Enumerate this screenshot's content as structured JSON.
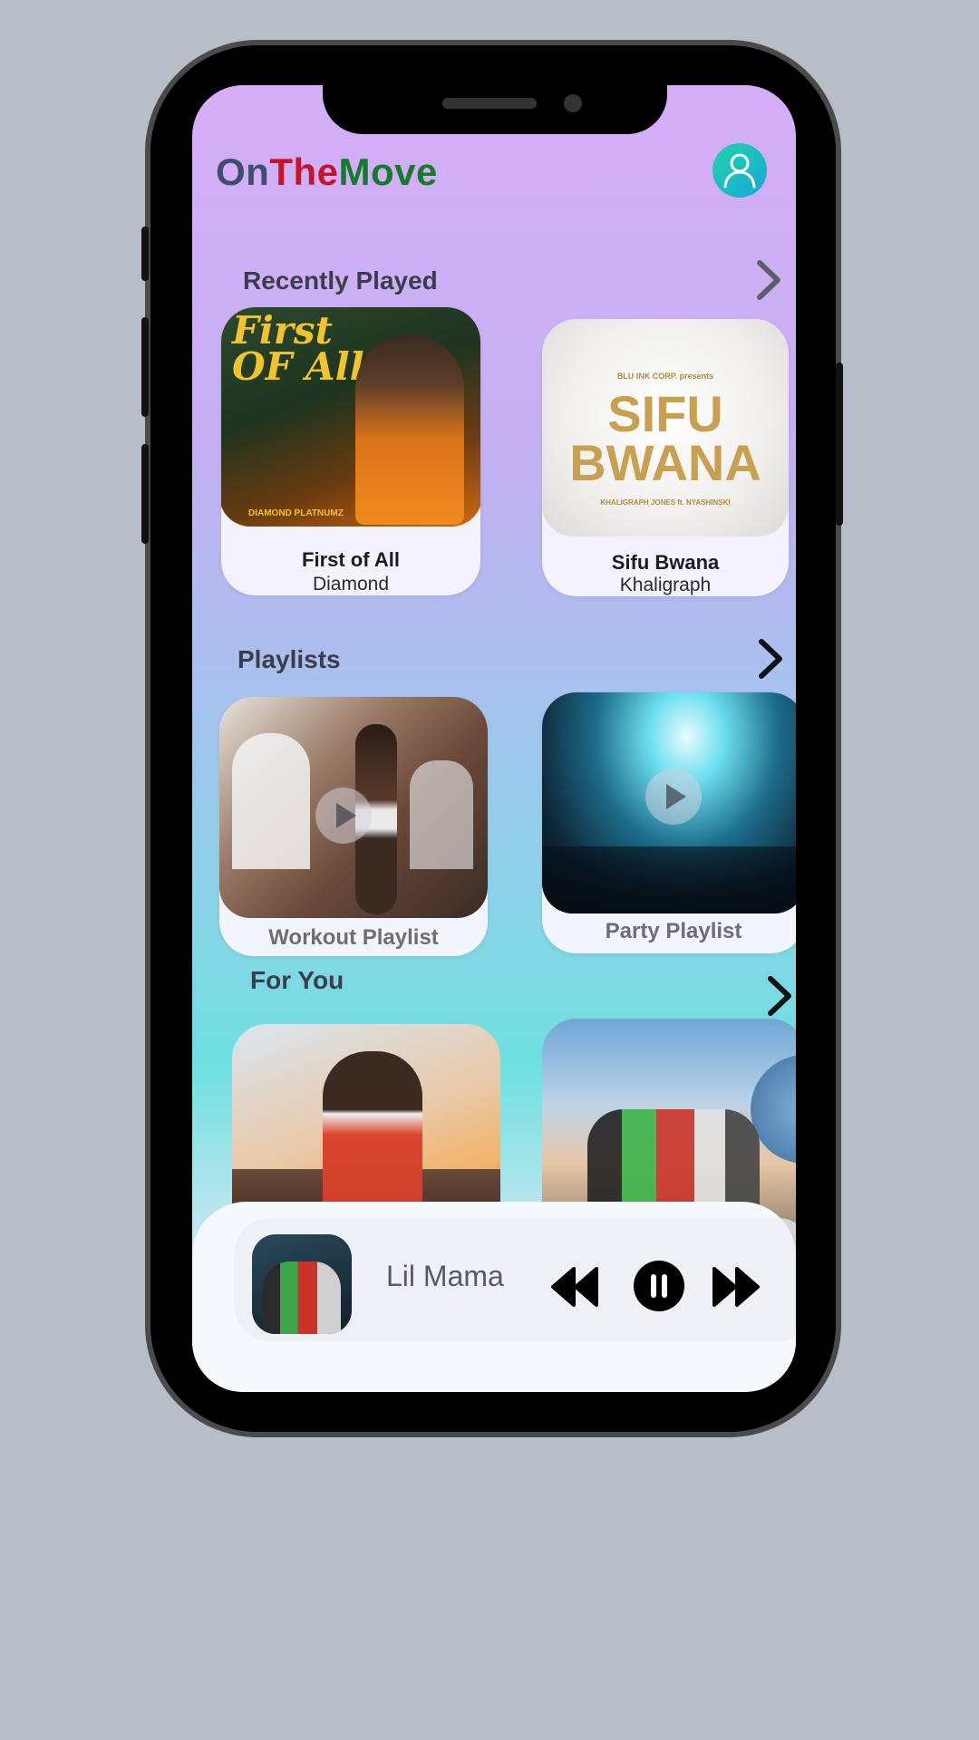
{
  "app": {
    "logo_part1": "On",
    "logo_part2": "The",
    "logo_part3": "Move"
  },
  "sections": {
    "recent": {
      "title": "Recently Played"
    },
    "playlists": {
      "title": "Playlists"
    },
    "for_you": {
      "title": "For You"
    }
  },
  "recent_items": [
    {
      "title": "First of All",
      "artist": "Diamond",
      "art_text": "First OF All",
      "art_caption": "DIAMOND PLATNUMZ"
    },
    {
      "title": "Sifu Bwana",
      "artist": "Khaligraph",
      "art_top": "BLU INK CORP. presents",
      "art_main1": "SIFU",
      "art_main2": "BWANA",
      "art_caption": "KHALIGRAPH JONES ft. NYASHINSKI"
    }
  ],
  "playlist_items": [
    {
      "label": "Workout Playlist"
    },
    {
      "label": "Party Playlist"
    }
  ],
  "now_playing": {
    "title": "Lil Mama"
  },
  "colors": {
    "logo_on": "#3f4d6f",
    "logo_the": "#c4142a",
    "logo_move": "#157a2c",
    "avatar_gradient_start": "#23d3a8",
    "avatar_gradient_end": "#17a7d8"
  },
  "icons": {
    "avatar": "user-icon",
    "section_more": "chevron-right-icon",
    "playlist_play": "play-icon",
    "rewind": "rewind-icon",
    "pause": "pause-icon",
    "forward": "fast-forward-icon"
  }
}
